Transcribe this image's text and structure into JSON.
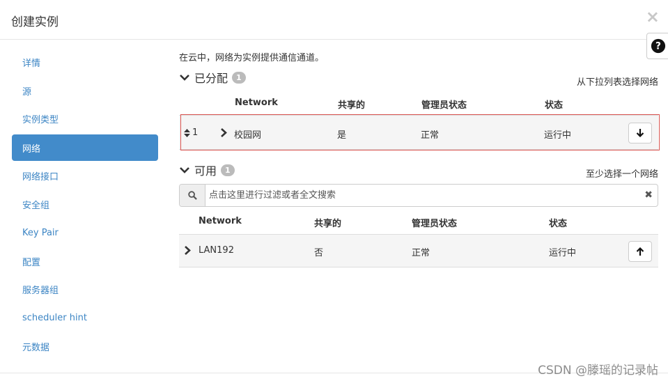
{
  "modal": {
    "title": "创建实例",
    "close_glyph": "×",
    "help_glyph": "?"
  },
  "sidebar": {
    "items": [
      {
        "label": "详情"
      },
      {
        "label": "源"
      },
      {
        "label": "实例类型"
      },
      {
        "label": "网络"
      },
      {
        "label": "网络接口"
      },
      {
        "label": "安全组"
      },
      {
        "label": "Key Pair"
      },
      {
        "label": "配置"
      },
      {
        "label": "服务器组"
      },
      {
        "label": "scheduler hint"
      },
      {
        "label": "元数据"
      }
    ],
    "active_index": 3
  },
  "intro": "在云中，网络为实例提供通信通道。",
  "allocated": {
    "title": "已分配",
    "count": "1",
    "hint": "从下拉列表选择网络",
    "columns": [
      "Network",
      "共享的",
      "管理员状态",
      "状态"
    ],
    "rows": [
      {
        "order": "1",
        "network": "校园网",
        "shared": "是",
        "admin_state": "正常",
        "status": "运行中"
      }
    ]
  },
  "available": {
    "title": "可用",
    "count": "1",
    "hint": "至少选择一个网络",
    "search_placeholder": "点击这里进行过滤或者全文搜索",
    "search_value": "",
    "clear_glyph": "✖",
    "columns": [
      "Network",
      "共享的",
      "管理员状态",
      "状态"
    ],
    "rows": [
      {
        "network": "LAN192",
        "shared": "否",
        "admin_state": "正常",
        "status": "运行中"
      }
    ]
  },
  "watermark": "CSDN @滕瑶的记录帖",
  "colors": {
    "accent": "#428bca",
    "link": "#3c85c4",
    "highlight_border": "#d9534f",
    "badge": "#bbbbbb"
  },
  "icons": [
    "question-circle-icon",
    "chevron-down-icon",
    "chevron-right-icon",
    "sort-icon",
    "arrow-down-icon",
    "arrow-up-icon",
    "search-icon",
    "clear-icon"
  ]
}
